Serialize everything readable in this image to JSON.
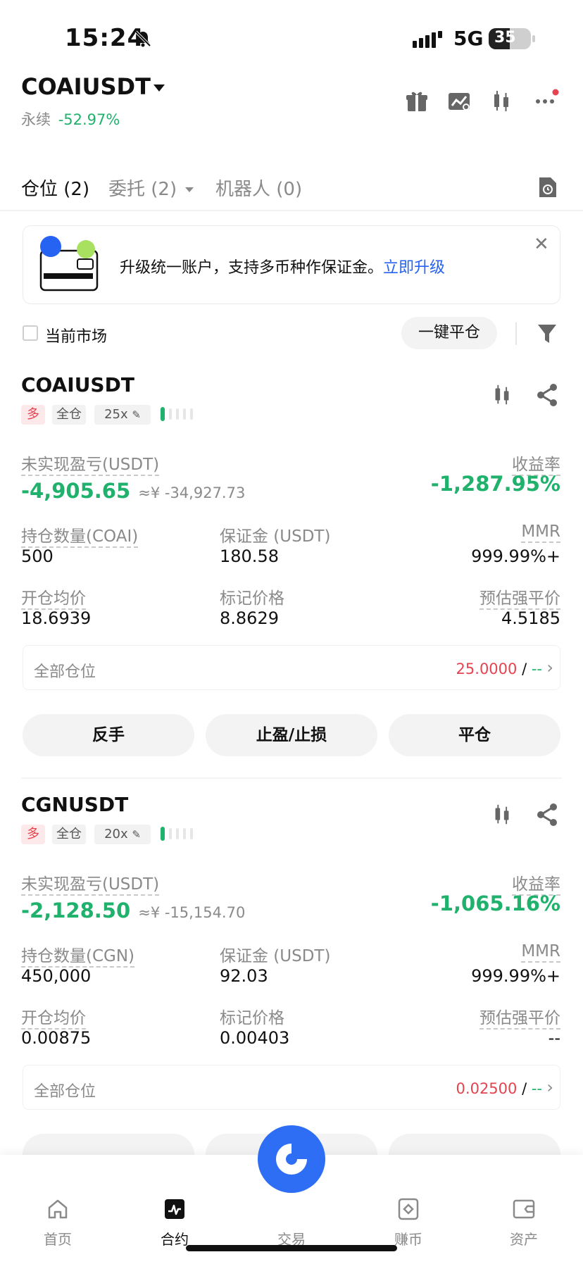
{
  "status_bar": {
    "time": "15:24",
    "network": "5G",
    "battery": "35"
  },
  "header": {
    "symbol": "COAIUSDT",
    "contract_type": "永续",
    "change": "-52.97%"
  },
  "tabs": [
    {
      "label": "仓位 (2)"
    },
    {
      "label": "委托 (2)"
    },
    {
      "label": "机器人 (0)"
    }
  ],
  "banner": {
    "text": "升级统一账户，支持多币种作保证金。",
    "link": "立即升级"
  },
  "filter": {
    "current_market": "当前市场",
    "close_all": "一键平仓"
  },
  "positions": [
    {
      "symbol": "COAIUSDT",
      "side": "多",
      "margin_mode": "全仓",
      "leverage": "25x",
      "pnl_label": "未实现盈亏(USDT)",
      "pnl": "-4,905.65",
      "pnl_cny": "≈¥ -34,927.73",
      "roe_label": "收益率",
      "roe": "-1,287.95%",
      "qty_label": "持仓数量(COAI)",
      "qty": "500",
      "margin_label": "保证金 (USDT)",
      "margin": "180.58",
      "mmr_label": "MMR",
      "mmr": "999.99%+",
      "entry_label": "开仓均价",
      "entry": "18.6939",
      "mark_label": "标记价格",
      "mark": "8.8629",
      "liq_label": "预估强平价",
      "liq": "4.5185",
      "all_label": "全部仓位",
      "all_value": "25.0000",
      "all_sep": "/",
      "all_value2": "--",
      "btn_reverse": "反手",
      "btn_tpsl": "止盈/止损",
      "btn_close": "平仓"
    },
    {
      "symbol": "CGNUSDT",
      "side": "多",
      "margin_mode": "全仓",
      "leverage": "20x",
      "pnl_label": "未实现盈亏(USDT)",
      "pnl": "-2,128.50",
      "pnl_cny": "≈¥ -15,154.70",
      "roe_label": "收益率",
      "roe": "-1,065.16%",
      "qty_label": "持仓数量(CGN)",
      "qty": "450,000",
      "margin_label": "保证金 (USDT)",
      "margin": "92.03",
      "mmr_label": "MMR",
      "mmr": "999.99%+",
      "entry_label": "开仓均价",
      "entry": "0.00875",
      "mark_label": "标记价格",
      "mark": "0.00403",
      "liq_label": "预估强平价",
      "liq": "--",
      "all_label": "全部仓位",
      "all_value": "0.02500",
      "all_sep": "/",
      "all_value2": "--"
    }
  ],
  "bottom_nav": [
    {
      "label": "首页"
    },
    {
      "label": "合约"
    },
    {
      "label": "交易"
    },
    {
      "label": "赚币"
    },
    {
      "label": "资产"
    }
  ],
  "colors": {
    "green": "#20b26c",
    "red": "#e5434f",
    "orange": "#f29a3f",
    "accent_blue": "#2e6ef5",
    "link_blue": "#2763f2"
  }
}
